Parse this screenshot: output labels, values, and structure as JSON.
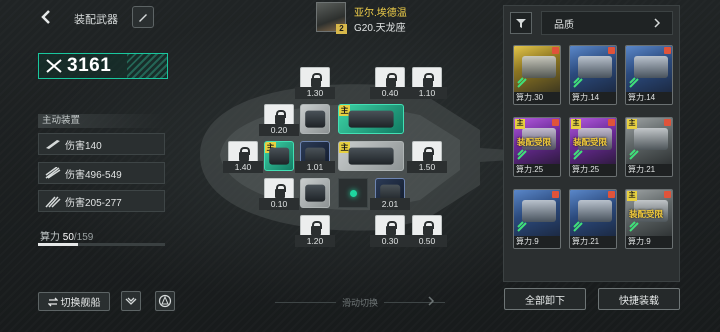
{
  "header": {
    "title": "装配武器"
  },
  "pilot": {
    "name": "亚尔.埃德温",
    "ship": "G20.天龙座",
    "level": "2"
  },
  "power": {
    "value": "3161"
  },
  "active_devices": {
    "header": "主动装置",
    "items": [
      {
        "label": "伤害140",
        "icon": "single-shot-icon"
      },
      {
        "label": "伤害496-549",
        "icon": "multi-shot-icon"
      },
      {
        "label": "伤害205-277",
        "icon": "missile-icon"
      }
    ]
  },
  "compute": {
    "label": "算力",
    "current": "50",
    "max": "/159",
    "fraction": 0.314
  },
  "slots": {
    "values": [
      "1.30",
      "0.40",
      "1.10",
      "0.20",
      "1.40",
      "1.01",
      "1.50",
      "0.10",
      "2.01",
      "1.20",
      "0.30",
      "0.50"
    ],
    "main_tag": "主"
  },
  "bottom_left": {
    "switch_ship": "切换舰船",
    "swipe_hint": "滑动切换"
  },
  "inventory": {
    "quality_label": "品质",
    "cards": [
      {
        "footer": "算力.30",
        "tier": "gold",
        "limit": "",
        "main": false
      },
      {
        "footer": "算力.14",
        "tier": "blue",
        "limit": "",
        "main": false
      },
      {
        "footer": "算力.14",
        "tier": "blue",
        "limit": "",
        "main": false
      },
      {
        "footer": "算力.25",
        "tier": "purple",
        "limit": "装配受限",
        "main": true
      },
      {
        "footer": "算力.25",
        "tier": "purple",
        "limit": "装配受限",
        "main": true
      },
      {
        "footer": "算力.21",
        "tier": "grey",
        "limit": "",
        "main": true
      },
      {
        "footer": "算力.9",
        "tier": "blue",
        "limit": "",
        "main": false
      },
      {
        "footer": "算力.21",
        "tier": "blue",
        "limit": "",
        "main": false
      },
      {
        "footer": "算力.9",
        "tier": "grey",
        "limit": "装配受限",
        "main": true
      }
    ],
    "unequip_all": "全部卸下",
    "quick_equip": "快捷装载"
  },
  "colors": {
    "accent": "#19c79e",
    "gold": "#e7d041",
    "limit": "#f0c93c"
  }
}
